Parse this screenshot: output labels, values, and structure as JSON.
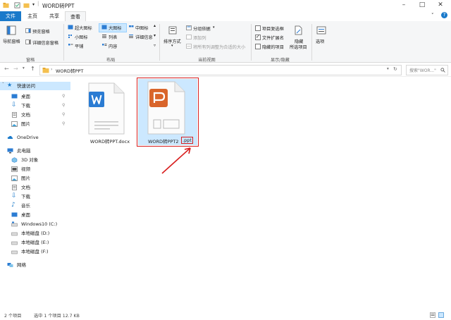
{
  "window": {
    "title": "WORD转PPT"
  },
  "tabs": [
    "文件",
    "主页",
    "共享",
    "查看"
  ],
  "ribbon": {
    "pane": {
      "nav_pane": "导航窗格",
      "preview_pane": "预览窗格",
      "details_pane": "详细信息窗格",
      "group": "窗格"
    },
    "layout": {
      "items": [
        "超大图标",
        "大图标",
        "中图标",
        "小图标",
        "列表",
        "详细信息",
        "平铺",
        "内容"
      ],
      "group": "布局"
    },
    "current_view": {
      "sort": "排序方式",
      "group_by": "分组依据",
      "add_columns": "添加列",
      "fit_columns": "将所有列调整为合适的大小",
      "group": "当前视图"
    },
    "show_hide": {
      "item_checkboxes": "项目复选框",
      "file_extensions": "文件扩展名",
      "hidden_items": "隐藏的项目",
      "hide_selected": "隐藏",
      "hide_selected_2": "所选项目",
      "group": "显示/隐藏"
    },
    "options": "选项"
  },
  "address": {
    "path": "WORD转PPT",
    "search_placeholder": "搜索\"WOR...\""
  },
  "nav": {
    "quick_access": "快速访问",
    "quick_items": [
      "桌面",
      "下载",
      "文档",
      "图片"
    ],
    "onedrive": "OneDrive",
    "this_pc": "此电脑",
    "pc_items": [
      "3D 对象",
      "视频",
      "图片",
      "文档",
      "下载",
      "音乐",
      "桌面",
      "Windows10 (C:)",
      "本地磁盘 (D:)",
      "本地磁盘 (E:)",
      "本地磁盘 (F:)"
    ],
    "network": "网络"
  },
  "files": [
    {
      "name": "WORD转PPT.docx",
      "type": "word"
    },
    {
      "name_base": "WORD转PPT2",
      "name_ext": ".ppt",
      "type": "ppt"
    }
  ],
  "status": {
    "count": "2 个项目",
    "selection": "选中 1 个项目 12.7 KB"
  },
  "colors": {
    "accent": "#1979ca",
    "word": "#2b7cd3",
    "ppt": "#d9652b",
    "highlight": "#d81e1e",
    "selection": "#cce8ff"
  }
}
